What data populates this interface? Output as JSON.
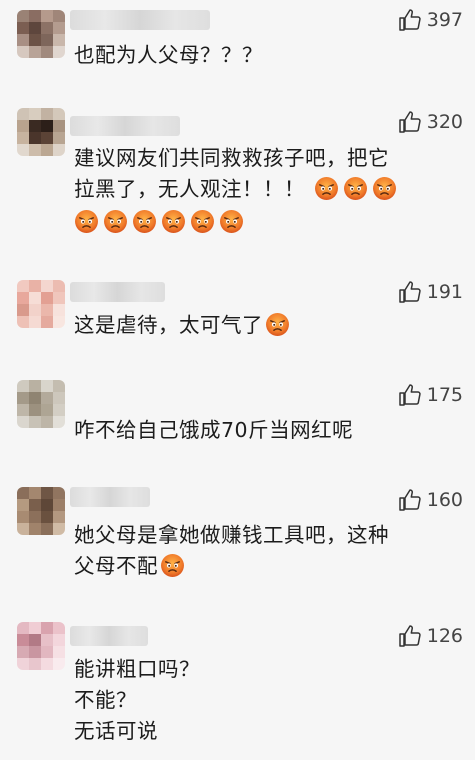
{
  "comments": [
    {
      "likes": "397",
      "lines": [
        "也配为人父母？？？"
      ],
      "emojis": 0,
      "avatar": [
        "#9a8275",
        "#8a6d62",
        "#b59a8c",
        "#a08679",
        "#7b5e52",
        "#5e463d",
        "#8c7266",
        "#b49c8f",
        "#a88f84",
        "#6c5246",
        "#7e665b",
        "#c9b7ab",
        "#d6c8bf",
        "#b8a397",
        "#a18a7e",
        "#e0d6cf"
      ]
    },
    {
      "likes": "320",
      "lines": [
        "建议网友们共同救救孩子吧，把它",
        "拉黑了，无人观注！！！"
      ],
      "emojis": 3,
      "line3_emojis": 6,
      "avatar": [
        "#cfc3b5",
        "#d8cdbf",
        "#c2b2a2",
        "#d4c8ba",
        "#b9a38e",
        "#3a2a22",
        "#2c1f19",
        "#a89380",
        "#c7b39f",
        "#4a352b",
        "#5b4336",
        "#b8a592",
        "#e1d8ce",
        "#cdbcaa",
        "#bba792",
        "#ded4c9"
      ]
    },
    {
      "likes": "191",
      "lines": [
        "这是虐待，太可气了"
      ],
      "emojis": 1,
      "avatar": [
        "#f1c9c0",
        "#e9b2a6",
        "#f4d6cf",
        "#ecbcb1",
        "#e8a89c",
        "#f6ddd6",
        "#e3a093",
        "#f0c6bc",
        "#d99a8c",
        "#f2d2ca",
        "#ebb7ab",
        "#f7e2dc",
        "#eec1b6",
        "#f5dad3",
        "#e5aa9e",
        "#f8e6e0"
      ]
    },
    {
      "likes": "175",
      "lines": [
        "咋不给自己饿成70斤当网红呢"
      ],
      "emojis": 0,
      "avatar": [
        "#cfcabf",
        "#b9b1a2",
        "#d9d5cc",
        "#c4bdb0",
        "#a49a89",
        "#8f8472",
        "#b3aa9b",
        "#cdc7bc",
        "#beb6a8",
        "#9c917f",
        "#aea594",
        "#d3cec4",
        "#dad6ce",
        "#c8c2b6",
        "#bdb5a7",
        "#e2dfd8"
      ]
    },
    {
      "likes": "160",
      "lines": [
        "她父母是拿她做赚钱工具吧，这种",
        "父母不配"
      ],
      "emojis": 1,
      "avatar": [
        "#8a6e5a",
        "#a4876f",
        "#6f5645",
        "#917560",
        "#b59a80",
        "#7a5f4c",
        "#5e4738",
        "#9c7f68",
        "#a88b72",
        "#8c705b",
        "#6a513f",
        "#b39880",
        "#c9b29b",
        "#a0836b",
        "#8a6f5a",
        "#d0bba5"
      ]
    },
    {
      "likes": "126",
      "lines": [
        "能讲粗口吗？",
        "不能？",
        "无话可说"
      ],
      "emojis": 0,
      "avatar": [
        "#e4b9c2",
        "#f0cdd4",
        "#d9a3ae",
        "#ebc2ca",
        "#c98c98",
        "#b27a86",
        "#e7c0c8",
        "#f3d6dc",
        "#d7aab3",
        "#c996a1",
        "#e2b7c0",
        "#f6e0e4",
        "#f0d3d9",
        "#e8c6cd",
        "#f4dbe0",
        "#f9ebee"
      ]
    }
  ]
}
